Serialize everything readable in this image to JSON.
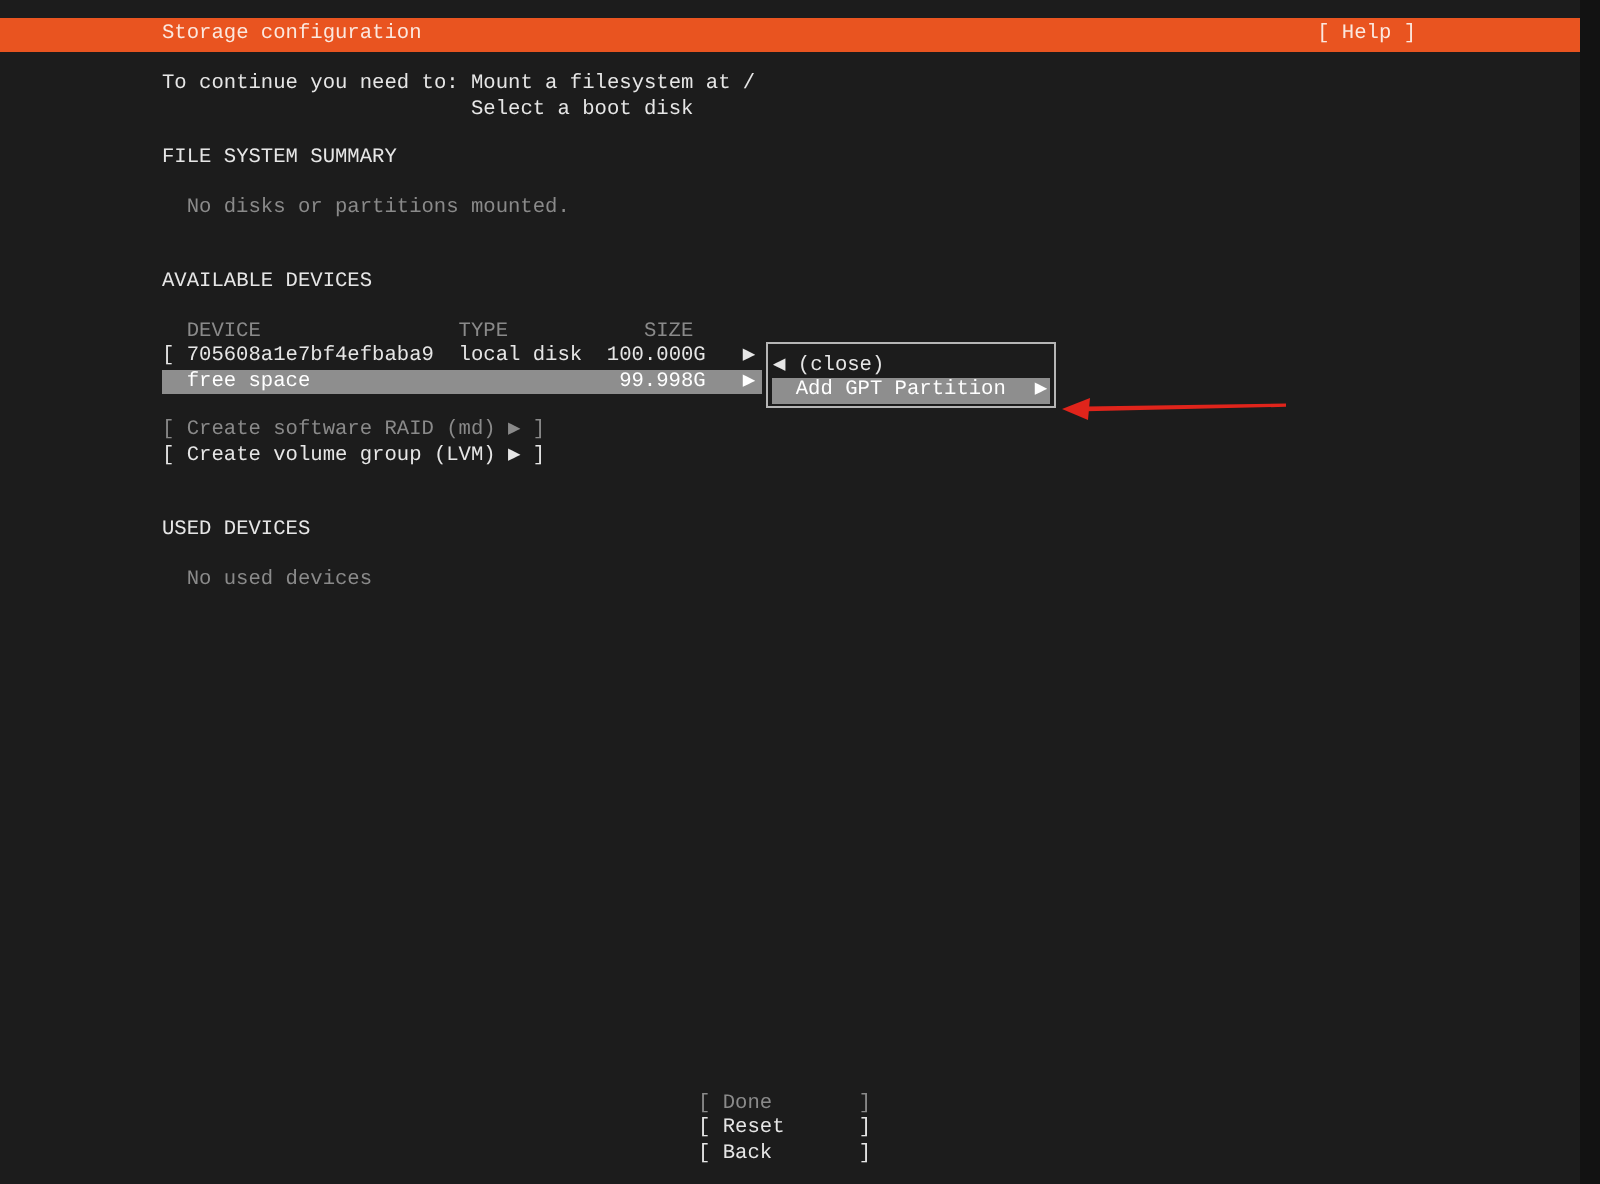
{
  "header": {
    "title": "Storage configuration",
    "help": "[ Help ]"
  },
  "requirements": {
    "label": "To continue you need to:",
    "items": [
      "Mount a filesystem at /",
      "Select a boot disk"
    ]
  },
  "file_system_summary": {
    "heading": "FILE SYSTEM SUMMARY",
    "empty_text": "No disks or partitions mounted."
  },
  "available_devices": {
    "heading": "AVAILABLE DEVICES",
    "columns": [
      "DEVICE",
      "TYPE",
      "SIZE"
    ],
    "rows": [
      {
        "bracket": "[",
        "device": "705608a1e7bf4efbaba9",
        "type": "local disk",
        "size": "100.000G",
        "arrow": "▶",
        "selected": false
      },
      {
        "device": "free space",
        "size": "99.998G",
        "arrow": "▶",
        "selected": true
      }
    ],
    "menu": [
      {
        "kind": "back",
        "arrow": "◀",
        "label": "(close)",
        "selected": false
      },
      {
        "kind": "forward",
        "arrow": "▶",
        "label": "Add GPT Partition",
        "selected": true
      }
    ],
    "actions": [
      {
        "label": "[ Create software RAID (md) ▶ ]",
        "disabled": true
      },
      {
        "label": "[ Create volume group (LVM) ▶ ]",
        "disabled": false
      }
    ]
  },
  "used_devices": {
    "heading": "USED DEVICES",
    "empty_text": "No used devices"
  },
  "buttons": [
    {
      "label": "[ Done       ]",
      "disabled": true
    },
    {
      "label": "[ Reset      ]",
      "disabled": false
    },
    {
      "label": "[ Back       ]",
      "disabled": false
    }
  ]
}
